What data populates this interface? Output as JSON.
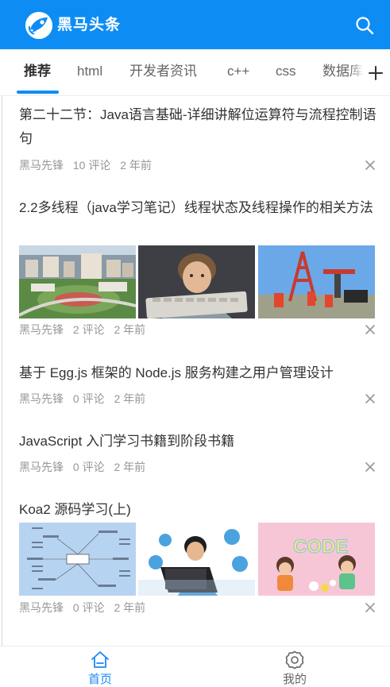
{
  "app": {
    "name": "黑马头条",
    "logo_icon": "rocket-logo-icon",
    "search_icon": "search-icon",
    "accent_color": "#0d8df4"
  },
  "channels": {
    "items": [
      "推荐",
      "html",
      "开发者资讯",
      "c++",
      "css",
      "数据库"
    ],
    "active_index": 0,
    "add_icon": "plus-icon"
  },
  "articles": [
    {
      "title": "第二十二节：Java语言基础-详细讲解位运算符与流程控制语句",
      "author": "黑马先锋",
      "comments": "10 评论",
      "time": "2 年前",
      "images": []
    },
    {
      "title": "2.2多线程（java学习笔记）线程状态及线程操作的相关方法",
      "author": "黑马先锋",
      "comments": "2 评论",
      "time": "2 年前",
      "images": [
        "campus-aerial-photo",
        "boy-at-keyboard-photo",
        "oil-drilling-rig-photo"
      ]
    },
    {
      "title": "基于 Egg.js 框架的 Node.js 服务构建之用户管理设计",
      "author": "黑马先锋",
      "comments": "0 评论",
      "time": "2 年前",
      "images": []
    },
    {
      "title": "JavaScript 入门学习书籍到阶段书籍",
      "author": "黑马先锋",
      "comments": "0 评论",
      "time": "2 年前",
      "images": []
    },
    {
      "title": "Koa2 源码学习(上)",
      "author": "黑马先锋",
      "comments": "0 评论",
      "time": "2 年前",
      "images": [
        "mind-map-image",
        "boy-with-laptop-image",
        "kids-code-illustration"
      ]
    }
  ],
  "tabbar": {
    "items": [
      {
        "label": "首页",
        "icon": "home-icon",
        "active": true
      },
      {
        "label": "我的",
        "icon": "settings-icon",
        "active": false
      }
    ],
    "active_color": "#1989fa",
    "inactive_color": "#646566"
  }
}
